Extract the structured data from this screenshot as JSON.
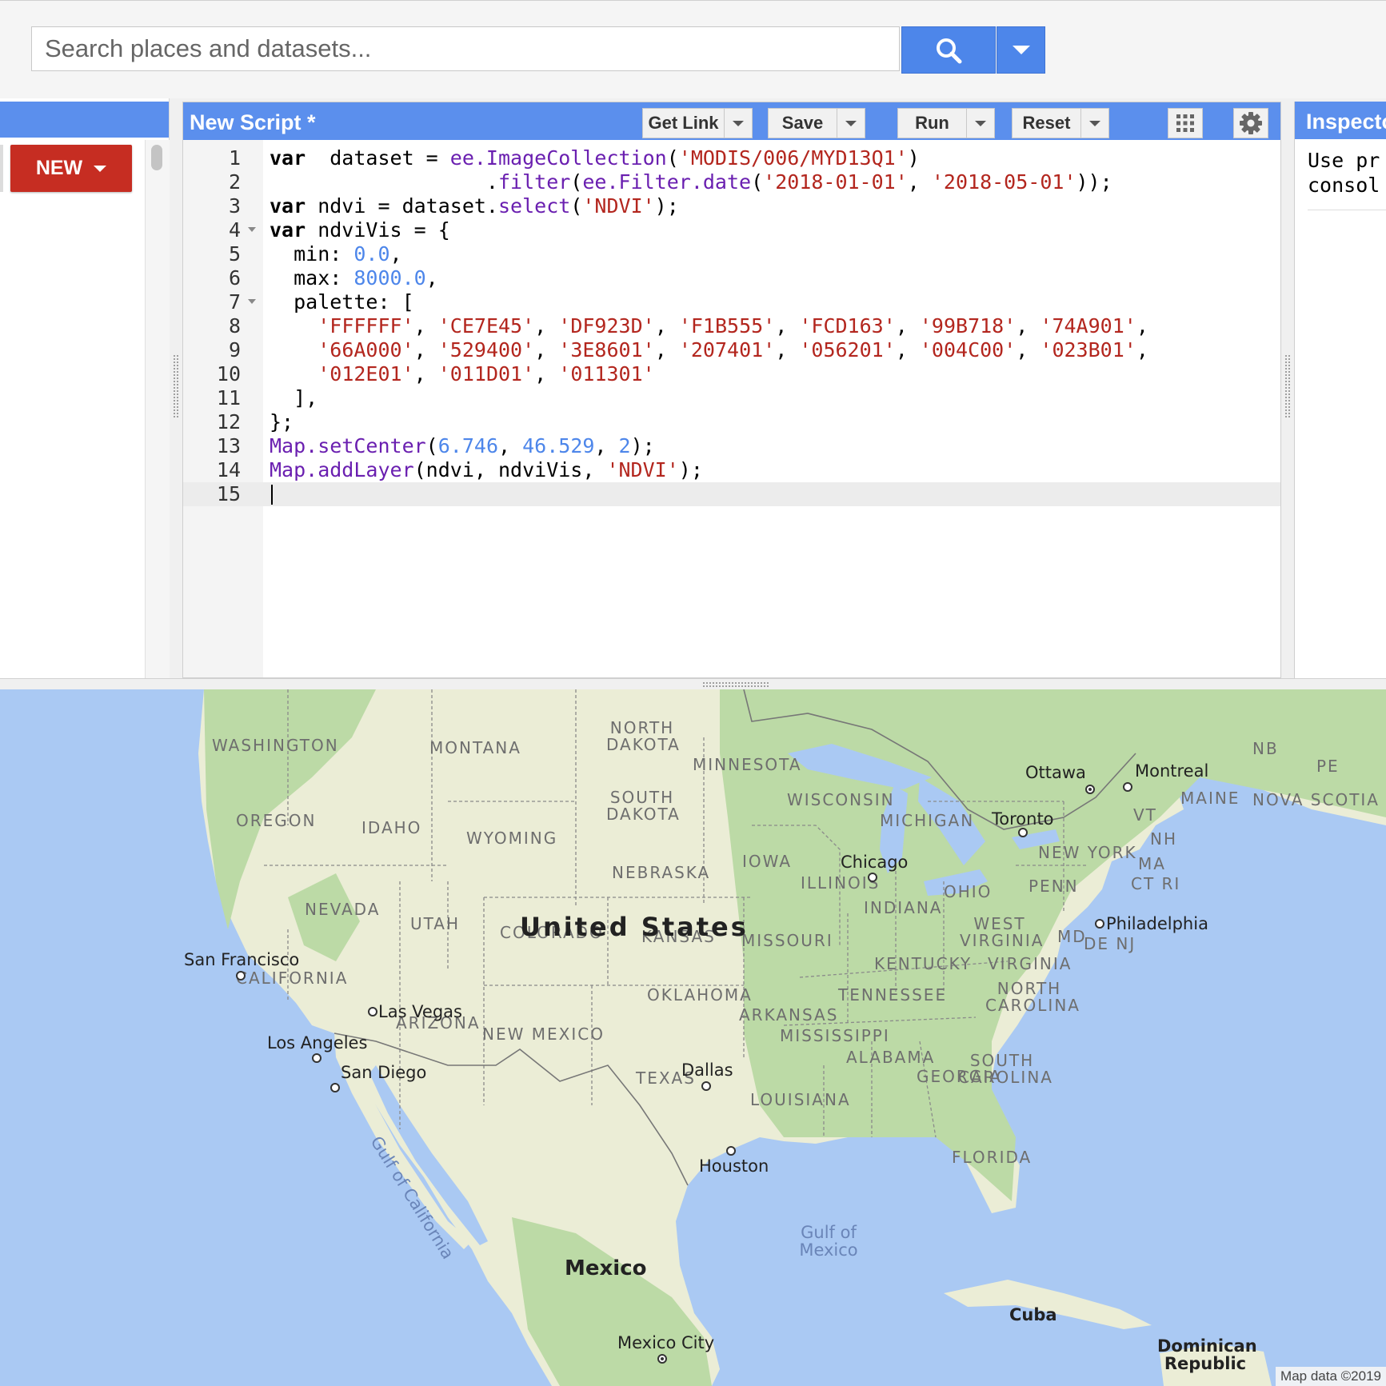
{
  "search": {
    "placeholder": "Search places and datasets...",
    "button_icon": "search-icon",
    "dropdown_icon": "caret-down-icon"
  },
  "scripts_panel": {
    "new_button_label": "NEW"
  },
  "editor": {
    "title": "New Script *",
    "buttons": {
      "get_link": "Get Link",
      "save": "Save",
      "run": "Run",
      "reset": "Reset"
    },
    "icons": {
      "apps": "apps-grid-icon",
      "settings": "gear-icon"
    },
    "lines": [
      {
        "n": "1",
        "fold": false,
        "tokens": [
          [
            "kw",
            "var"
          ],
          [
            "",
            "  dataset = "
          ],
          [
            "fn",
            "ee.ImageCollection"
          ],
          [
            "",
            "("
          ],
          [
            "str",
            "'MODIS/006/MYD13Q1'"
          ],
          [
            "",
            ")"
          ]
        ]
      },
      {
        "n": "2",
        "fold": false,
        "tokens": [
          [
            "",
            "                  ."
          ],
          [
            "fn",
            "filter"
          ],
          [
            "",
            "("
          ],
          [
            "fn",
            "ee.Filter.date"
          ],
          [
            "",
            "("
          ],
          [
            "str",
            "'2018-01-01'"
          ],
          [
            "",
            ", "
          ],
          [
            "str",
            "'2018-05-01'"
          ],
          [
            "",
            "));"
          ]
        ]
      },
      {
        "n": "3",
        "fold": false,
        "tokens": [
          [
            "kw",
            "var"
          ],
          [
            "",
            " ndvi = dataset."
          ],
          [
            "fn",
            "select"
          ],
          [
            "",
            "("
          ],
          [
            "str",
            "'NDVI'"
          ],
          [
            "",
            ");"
          ]
        ]
      },
      {
        "n": "4",
        "fold": true,
        "tokens": [
          [
            "kw",
            "var"
          ],
          [
            "",
            " ndviVis = {"
          ]
        ]
      },
      {
        "n": "5",
        "fold": false,
        "tokens": [
          [
            "",
            "  min: "
          ],
          [
            "num",
            "0.0"
          ],
          [
            "",
            ","
          ]
        ]
      },
      {
        "n": "6",
        "fold": false,
        "tokens": [
          [
            "",
            "  max: "
          ],
          [
            "num",
            "8000.0"
          ],
          [
            "",
            ","
          ]
        ]
      },
      {
        "n": "7",
        "fold": true,
        "tokens": [
          [
            "",
            "  palette: ["
          ]
        ]
      },
      {
        "n": "8",
        "fold": false,
        "tokens": [
          [
            "",
            "    "
          ],
          [
            "str",
            "'FFFFFF'"
          ],
          [
            "",
            ", "
          ],
          [
            "str",
            "'CE7E45'"
          ],
          [
            "",
            ", "
          ],
          [
            "str",
            "'DF923D'"
          ],
          [
            "",
            ", "
          ],
          [
            "str",
            "'F1B555'"
          ],
          [
            "",
            ", "
          ],
          [
            "str",
            "'FCD163'"
          ],
          [
            "",
            ", "
          ],
          [
            "str",
            "'99B718'"
          ],
          [
            "",
            ", "
          ],
          [
            "str",
            "'74A901'"
          ],
          [
            "",
            ","
          ]
        ]
      },
      {
        "n": "9",
        "fold": false,
        "tokens": [
          [
            "",
            "    "
          ],
          [
            "str",
            "'66A000'"
          ],
          [
            "",
            ", "
          ],
          [
            "str",
            "'529400'"
          ],
          [
            "",
            ", "
          ],
          [
            "str",
            "'3E8601'"
          ],
          [
            "",
            ", "
          ],
          [
            "str",
            "'207401'"
          ],
          [
            "",
            ", "
          ],
          [
            "str",
            "'056201'"
          ],
          [
            "",
            ", "
          ],
          [
            "str",
            "'004C00'"
          ],
          [
            "",
            ", "
          ],
          [
            "str",
            "'023B01'"
          ],
          [
            "",
            ","
          ]
        ]
      },
      {
        "n": "10",
        "fold": false,
        "tokens": [
          [
            "",
            "    "
          ],
          [
            "str",
            "'012E01'"
          ],
          [
            "",
            ", "
          ],
          [
            "str",
            "'011D01'"
          ],
          [
            "",
            ", "
          ],
          [
            "str",
            "'011301'"
          ]
        ]
      },
      {
        "n": "11",
        "fold": false,
        "tokens": [
          [
            "",
            "  ],"
          ]
        ]
      },
      {
        "n": "12",
        "fold": false,
        "tokens": [
          [
            "",
            "};"
          ]
        ]
      },
      {
        "n": "13",
        "fold": false,
        "tokens": [
          [
            "fn",
            "Map.setCenter"
          ],
          [
            "",
            "("
          ],
          [
            "num",
            "6.746"
          ],
          [
            "",
            ", "
          ],
          [
            "num",
            "46.529"
          ],
          [
            "",
            ", "
          ],
          [
            "num",
            "2"
          ],
          [
            "",
            ");"
          ]
        ]
      },
      {
        "n": "14",
        "fold": false,
        "tokens": [
          [
            "fn",
            "Map.addLayer"
          ],
          [
            "",
            "(ndvi, ndviVis, "
          ],
          [
            "str",
            "'NDVI'"
          ],
          [
            "",
            ");"
          ]
        ]
      },
      {
        "n": "15",
        "fold": false,
        "tokens": []
      }
    ],
    "active_line": "15"
  },
  "inspector": {
    "tab_label": "Inspector",
    "message_line1": "Use pr",
    "message_line2": "consol"
  },
  "map": {
    "colors": {
      "water": "#aac9f3",
      "land": "#e9ecd4",
      "forest": "#b9d8a2"
    },
    "countries": [
      "United States",
      "Mexico"
    ],
    "states": [
      "WASHINGTON",
      "MONTANA",
      "NORTH DAKOTA",
      "MINNESOTA",
      "OREGON",
      "IDAHO",
      "SOUTH DAKOTA",
      "WISCONSIN",
      "MICHIGAN",
      "WYOMING",
      "IOWA",
      "NEBRASKA",
      "NEVADA",
      "ILLINOIS",
      "OHIO",
      "PENN",
      "INDIANA",
      "UTAH",
      "COLORADO",
      "KANSAS",
      "MISSOURI",
      "WEST VIRGINIA",
      "VIRGINIA",
      "KENTUCKY",
      "CALIFORNIA",
      "OKLAHOMA",
      "TENNESSEE",
      "NORTH CAROLINA",
      "ARKANSAS",
      "ARIZONA",
      "NEW MEXICO",
      "MISSISSIPPI",
      "ALABAMA",
      "GEORGIA",
      "SOUTH CAROLINA",
      "TEXAS",
      "LOUISIANA",
      "FLORIDA",
      "NEW YORK",
      "VT",
      "NH",
      "MAINE",
      "MA",
      "CT RI",
      "MD",
      "DE NJ",
      "NB",
      "PE",
      "NOVA SCOTIA"
    ],
    "cities": [
      "Ottawa",
      "Montreal",
      "Toronto",
      "Chicago",
      "Philadelphia",
      "San Francisco",
      "Las Vegas",
      "Los Angeles",
      "San Diego",
      "Dallas",
      "Houston",
      "Mexico City"
    ],
    "islands": [
      "Cuba",
      "Dominican Republic"
    ],
    "water_bodies": [
      "Gulf of Mexico",
      "Gulf of California"
    ],
    "attribution": "Map data ©2019"
  }
}
